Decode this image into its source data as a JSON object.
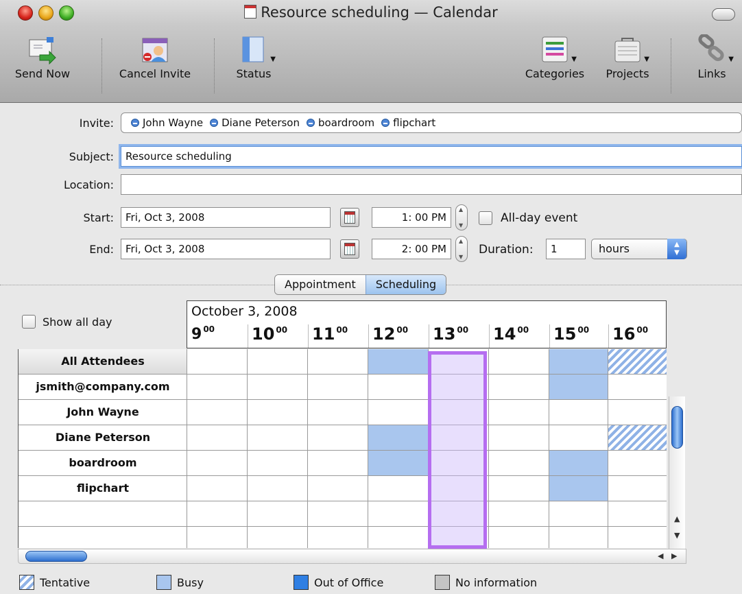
{
  "window": {
    "title": "Resource scheduling — Calendar"
  },
  "toolbar": {
    "send_now": "Send Now",
    "cancel_invite": "Cancel Invite",
    "status": "Status",
    "categories": "Categories",
    "projects": "Projects",
    "links": "Links"
  },
  "form": {
    "invite_label": "Invite:",
    "invitees": [
      "John Wayne",
      "Diane Peterson",
      "boardroom",
      "flipchart"
    ],
    "subject_label": "Subject:",
    "subject_value": "Resource scheduling",
    "location_label": "Location:",
    "location_value": "",
    "start_label": "Start:",
    "start_date": "Fri, Oct 3, 2008",
    "start_time": "1: 00 PM",
    "all_day_label": "All-day event",
    "end_label": "End:",
    "end_date": "Fri, Oct 3, 2008",
    "end_time": "2: 00 PM",
    "duration_label": "Duration:",
    "duration_value": "1",
    "duration_unit": "hours"
  },
  "tabs": {
    "appointment": "Appointment",
    "scheduling": "Scheduling"
  },
  "scheduler": {
    "show_all_day_label": "Show all day",
    "date_header": "October 3, 2008",
    "hours": [
      "9",
      "10",
      "11",
      "12",
      "13",
      "14",
      "15",
      "16"
    ],
    "hour_suffix": "00",
    "attendees": [
      "All Attendees",
      "jsmith@company.com",
      "John Wayne",
      "Diane Peterson",
      "boardroom",
      "flipchart",
      "",
      ""
    ]
  },
  "legend": {
    "tentative": "Tentative",
    "busy": "Busy",
    "out_of_office": "Out of Office",
    "no_information": "No information"
  },
  "colors": {
    "busy": "#a9c6ee",
    "tentative": "#8fb2e6",
    "out_of_office": "#2f7fe3",
    "no_information": "#c4c4c4",
    "selection": "#b56ef0"
  }
}
